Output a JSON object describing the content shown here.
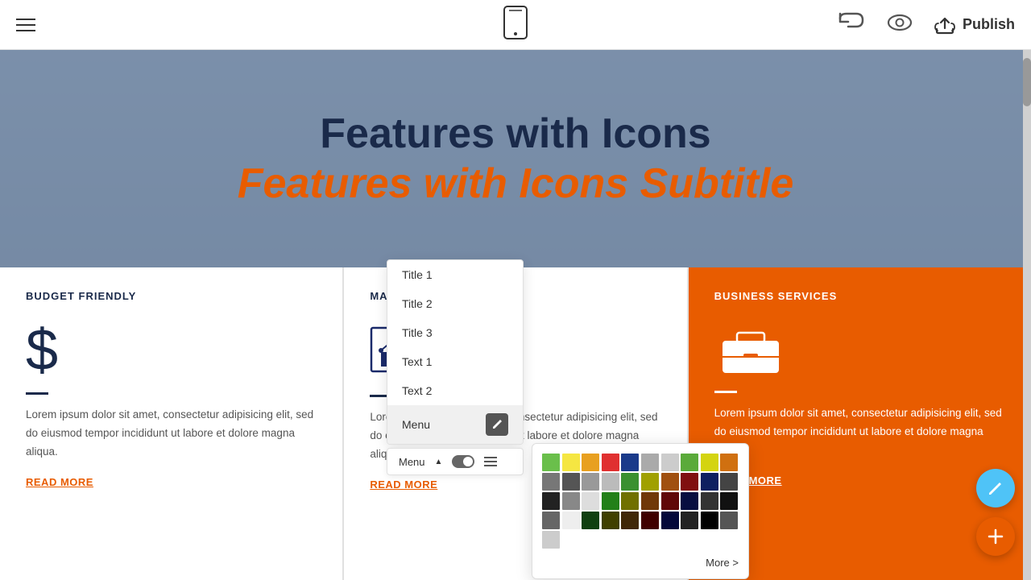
{
  "toolbar": {
    "publish_label": "Publish",
    "undo_symbol": "↩",
    "phone_label": "Mobile view"
  },
  "hero": {
    "title": "Features with Icons",
    "subtitle": "Features with Icons Subtitle"
  },
  "cards": [
    {
      "id": "budget",
      "title": "BUDGET FRIENDLY",
      "icon_type": "dollar",
      "text": "Lorem ipsum dolor sit amet, consectetur adipisicing elit, sed do eiusmod tempor incididunt ut labore et dolore magna aliqua.",
      "link": "READ MORE"
    },
    {
      "id": "market",
      "title": "MARKET ANA",
      "icon_type": "chart",
      "text": "Lorem ipsum dolor sit amet, consectetur adipisicing elit, sed do eiusmod tempor incididunt ut labore et dolore magna aliqua.",
      "link": "READ MORE"
    },
    {
      "id": "business",
      "title": "BUSINESS SERVICES",
      "icon_type": "briefcase",
      "text": "Lorem ipsum dolor sit amet, consectetur adipisicing elit, sed do eiusmod tempor incididunt ut labore et dolore magna aliqua.",
      "link": "READ MORE",
      "orange": true
    }
  ],
  "dropdown": {
    "items": [
      {
        "label": "Title 1"
      },
      {
        "label": "Title 2"
      },
      {
        "label": "Title 3"
      },
      {
        "label": "Text 1",
        "active": true
      },
      {
        "label": "Text 2"
      },
      {
        "label": "Menu",
        "has_edit": true
      }
    ],
    "menu_bar_label": "Menu",
    "more_label": "More >"
  },
  "color_swatches": [
    "#6abf4b",
    "#f5e642",
    "#e8a020",
    "#e03030",
    "#1a3a8a",
    "#aaaaaa",
    "#cccccc",
    "#5aaa3a",
    "#d4d410",
    "#d07010",
    "#777777",
    "#555555",
    "#999999",
    "#bbbbbb",
    "#3a9030",
    "#a0a000",
    "#a05010",
    "#801010",
    "#0e2060",
    "#444444",
    "#222222",
    "#888888",
    "#dddddd",
    "#228018",
    "#707000",
    "#703808",
    "#600808",
    "#080e40",
    "#333333",
    "#111111",
    "#666666",
    "#eeeeee",
    "#104010",
    "#404000",
    "#402808",
    "#400000",
    "#04083a",
    "#222222",
    "#000000",
    "#555555",
    "#cccccc"
  ]
}
